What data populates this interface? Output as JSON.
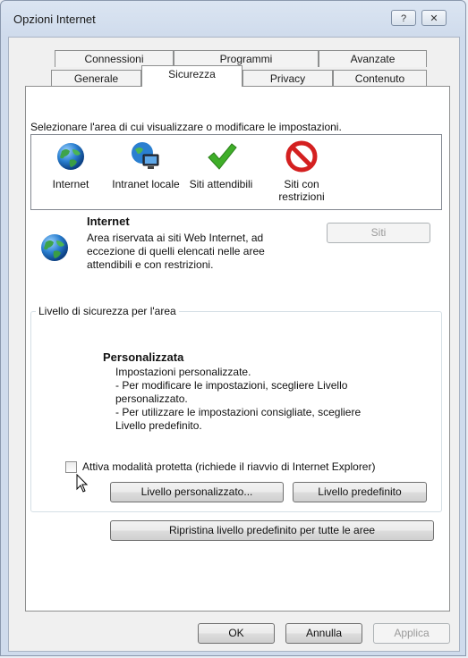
{
  "window": {
    "title": "Opzioni Internet",
    "help_button": "?",
    "close_button": "✕"
  },
  "tabs": {
    "row1": [
      "Connessioni",
      "Programmi",
      "Avanzate"
    ],
    "row2": [
      "Generale",
      "Sicurezza",
      "Privacy",
      "Contenuto"
    ],
    "active": "Sicurezza"
  },
  "security": {
    "instruction": "Selezionare l'area di cui visualizzare o modificare le impostazioni.",
    "zones": [
      {
        "label": "Internet",
        "icon": "globe-icon"
      },
      {
        "label": "Intranet locale",
        "icon": "intranet-icon"
      },
      {
        "label": "Siti attendibili",
        "icon": "checkmark-icon"
      },
      {
        "label": "Siti con restrizioni",
        "icon": "no-entry-icon"
      }
    ],
    "selected_zone": {
      "title": "Internet",
      "description": "Area riservata ai siti Web Internet, ad eccezione di quelli elencati nelle aree attendibili e con restrizioni.",
      "sites_button": "Siti"
    },
    "level_group": {
      "legend": "Livello di sicurezza per l'area",
      "level_name": "Personalizzata",
      "lines": [
        "Impostazioni personalizzate.",
        "- Per modificare le impostazioni, scegliere Livello",
        "personalizzato.",
        "- Per utilizzare le impostazioni consigliate, scegliere",
        "Livello predefinito."
      ],
      "protected_mode_label": "Attiva modalità protetta (richiede il riavvio di Internet Explorer)",
      "protected_mode_checked": false,
      "custom_level_button": "Livello personalizzato...",
      "default_level_button": "Livello predefinito"
    },
    "reset_all_button": "Ripristina livello predefinito per tutte le aree"
  },
  "footer": {
    "ok": "OK",
    "cancel": "Annulla",
    "apply": "Applica"
  },
  "colors": {
    "frame": "#cfdbec",
    "panel": "#ffffff",
    "no_entry": "#d42020",
    "check": "#3fae29"
  }
}
